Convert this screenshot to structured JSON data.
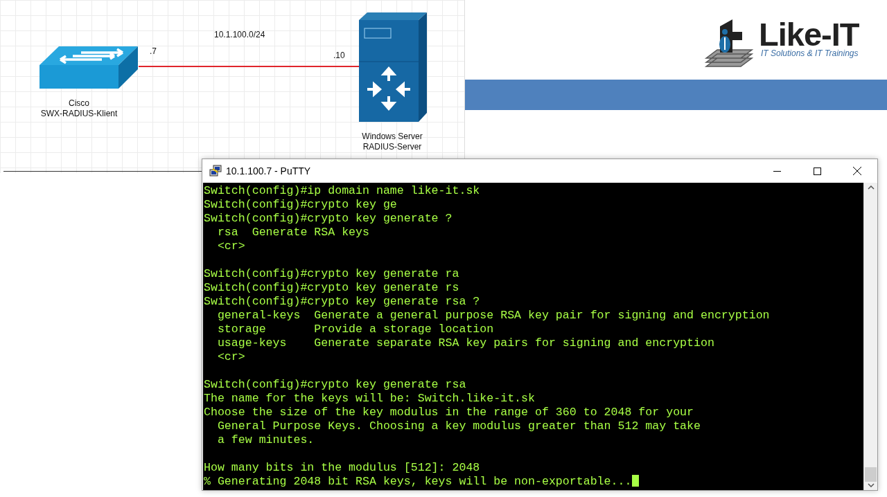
{
  "diagram": {
    "network_label": "10.1.100.0/24",
    "nodes": [
      {
        "kind": "switch",
        "label_lines": [
          "Cisco",
          "SWX-RADIUS-Klient"
        ],
        "address": ".7"
      },
      {
        "kind": "server",
        "label_lines": [
          "Windows Server",
          "RADIUS-Server"
        ],
        "address": ".10"
      }
    ]
  },
  "logo": {
    "name": "Like-IT",
    "tagline": "IT Solutions & IT Trainings"
  },
  "putty": {
    "title": "10.1.100.7 - PuTTY",
    "blocks": [
      [
        "Switch(config)#ip domain name like-it.sk",
        "Switch(config)#crypto key ge",
        "Switch(config)#crypto key generate ?",
        "  rsa  Generate RSA keys",
        "  <cr>"
      ],
      [
        "Switch(config)#crypto key generate ra",
        "Switch(config)#crypto key generate rs",
        "Switch(config)#crypto key generate rsa ?",
        "  general-keys  Generate a general purpose RSA key pair for signing and encryption",
        "  storage       Provide a storage location",
        "  usage-keys    Generate separate RSA key pairs for signing and encryption",
        "  <cr>"
      ],
      [
        "Switch(config)#crypto key generate rsa",
        "The name for the keys will be: Switch.like-it.sk",
        "Choose the size of the key modulus in the range of 360 to 2048 for your",
        "  General Purpose Keys. Choosing a key modulus greater than 512 may take",
        "  a few minutes."
      ],
      [
        "How many bits in the modulus [512]: 2048",
        "% Generating 2048 bit RSA keys, keys will be non-exportable..."
      ]
    ]
  }
}
